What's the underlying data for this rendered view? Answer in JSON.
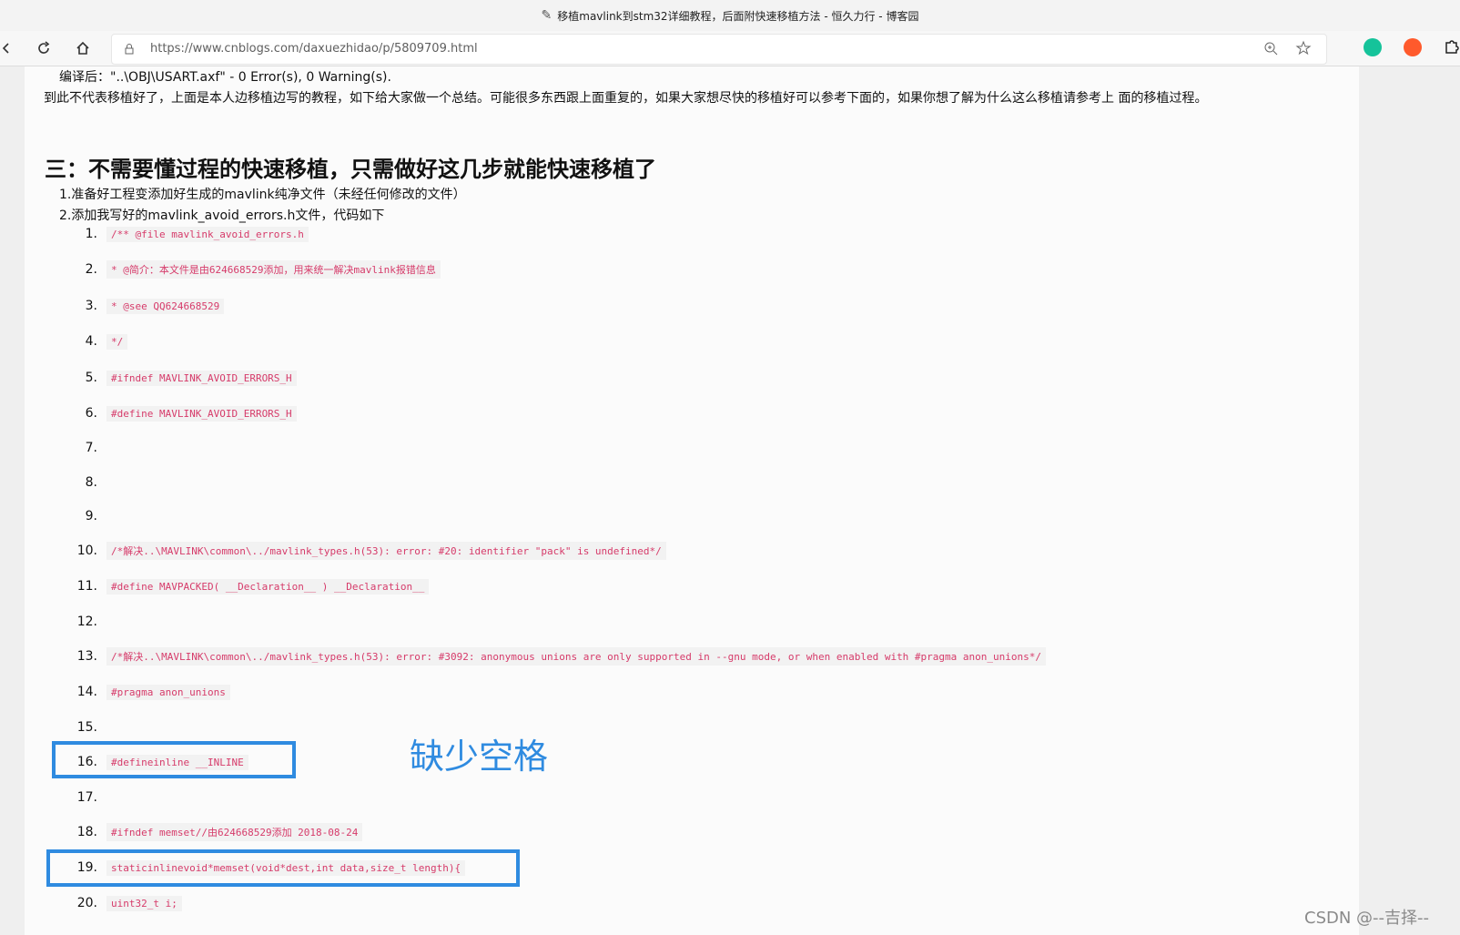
{
  "window": {
    "title": "移植mavlink到stm32详细教程，后面附快速移植方法 - 恒久力行 - 博客园"
  },
  "toolbar": {
    "url": "https://www.cnblogs.com/daxuezhidao/p/5809709.html",
    "icons": [
      "back-icon",
      "refresh-icon",
      "home-icon",
      "lock-icon",
      "zoom-icon",
      "favorite-icon",
      "grammarly-icon",
      "extension-icon",
      "puzzle-icon"
    ]
  },
  "article": {
    "compile_result": "编译后：\"..\\OBJ\\USART.axf\" - 0 Error(s), 0 Warning(s).",
    "summary": "到此不代表移植好了，上面是本人边移植边写的教程，如下给大家做一个总结。可能很多东西跟上面重复的，如果大家想尽快的移植好可以参考下面的，如果你想了解为什么这么移植请参考上  面的移植过程。",
    "heading": "三：不需要懂过程的快速移植，只需做好这几步就能快速移植了",
    "steps": [
      "1.准备好工程变添加好生成的mavlink纯净文件（未经任何修改的文件）",
      "2.添加我写好的mavlink_avoid_errors.h文件，代码如下"
    ],
    "code": [
      {
        "num": "1.",
        "text": "/** @file mavlink_avoid_errors.h"
      },
      {
        "num": "2.",
        "text": "* @简介：本文件是由624668529添加，用来统一解决mavlink报错信息"
      },
      {
        "num": "3.",
        "text": "* @see QQ624668529"
      },
      {
        "num": "4.",
        "text": "*/"
      },
      {
        "num": "5.",
        "text": "#ifndef MAVLINK_AVOID_ERRORS_H"
      },
      {
        "num": "6.",
        "text": "#define MAVLINK_AVOID_ERRORS_H"
      },
      {
        "num": "7.",
        "text": ""
      },
      {
        "num": "8.",
        "text": ""
      },
      {
        "num": "9.",
        "text": ""
      },
      {
        "num": "10.",
        "text": "/*解决..\\MAVLINK\\common\\../mavlink_types.h(53): error: #20: identifier \"pack\" is undefined*/"
      },
      {
        "num": "11.",
        "text": "#define MAVPACKED( __Declaration__ ) __Declaration__"
      },
      {
        "num": "12.",
        "text": ""
      },
      {
        "num": "13.",
        "text": "/*解决..\\MAVLINK\\common\\../mavlink_types.h(53): error: #3092: anonymous unions are only supported in --gnu mode, or when enabled with #pragma anon_unions*/"
      },
      {
        "num": "14.",
        "text": "#pragma anon_unions"
      },
      {
        "num": "15.",
        "text": ""
      },
      {
        "num": "16.",
        "text": "#defineinline __INLINE"
      },
      {
        "num": "17.",
        "text": ""
      },
      {
        "num": "18.",
        "text": "#ifndef memset//由624668529添加 2018-08-24"
      },
      {
        "num": "19.",
        "text": "staticinlinevoid*memset(void*dest,int data,size_t length){"
      },
      {
        "num": "20.",
        "text": "uint32_t i;"
      }
    ],
    "annotation": "缺少空格"
  },
  "watermark": "CSDN @--吉择--",
  "colors": {
    "highlight": "#2f8be0",
    "code_text": "#d63b6a",
    "code_bg": "#f2f2f2"
  }
}
